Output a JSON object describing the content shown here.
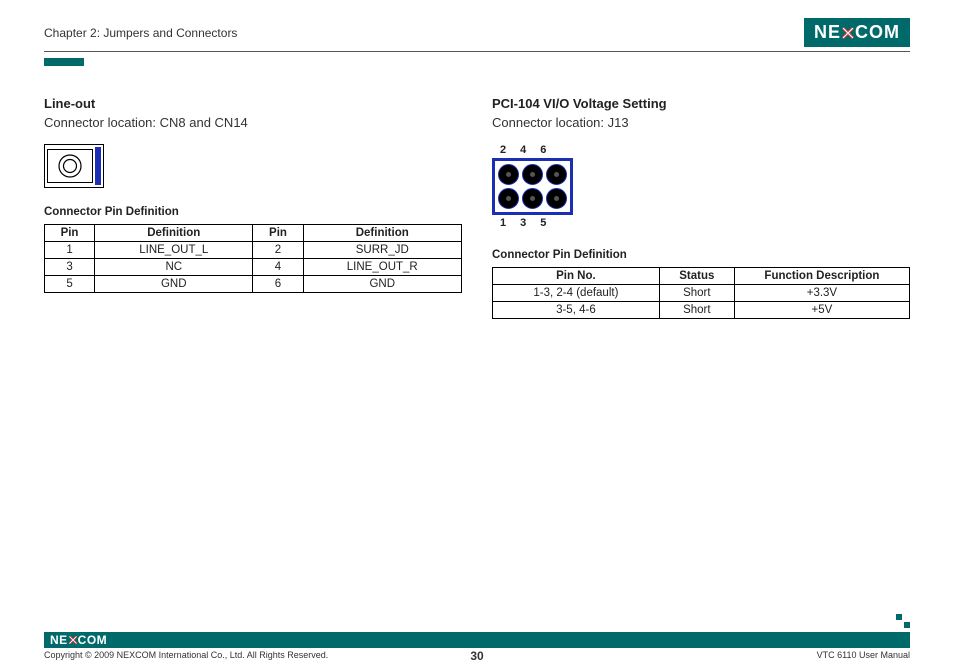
{
  "header": {
    "chapter": "Chapter 2: Jumpers and Connectors",
    "logo_a": "NE",
    "logo_b": "COM"
  },
  "left": {
    "title": "Line-out",
    "location": "Connector location: CN8 and CN14",
    "table_caption": "Connector Pin Definition",
    "headers": {
      "pin": "Pin",
      "def": "Definition"
    },
    "rows": [
      {
        "p1": "1",
        "d1": "LINE_OUT_L",
        "p2": "2",
        "d2": "SURR_JD"
      },
      {
        "p1": "3",
        "d1": "NC",
        "p2": "4",
        "d2": "LINE_OUT_R"
      },
      {
        "p1": "5",
        "d1": "GND",
        "p2": "6",
        "d2": "GND"
      }
    ]
  },
  "right": {
    "title": "PCI-104 VI/O Voltage Setting",
    "location": "Connector location: J13",
    "pin_labels_top": [
      "2",
      "4",
      "6"
    ],
    "pin_labels_bottom": [
      "1",
      "3",
      "5"
    ],
    "table_caption": "Connector Pin Definition",
    "headers": {
      "pin": "Pin No.",
      "status": "Status",
      "func": "Function Description"
    },
    "rows": [
      {
        "pin": "1-3, 2-4 (default)",
        "status": "Short",
        "func": "+3.3V"
      },
      {
        "pin": "3-5, 4-6",
        "status": "Short",
        "func": "+5V"
      }
    ]
  },
  "footer": {
    "logo_a": "NE",
    "logo_b": "COM",
    "copyright": "Copyright © 2009 NEXCOM International Co., Ltd. All Rights Reserved.",
    "page": "30",
    "manual": "VTC 6110 User Manual"
  }
}
